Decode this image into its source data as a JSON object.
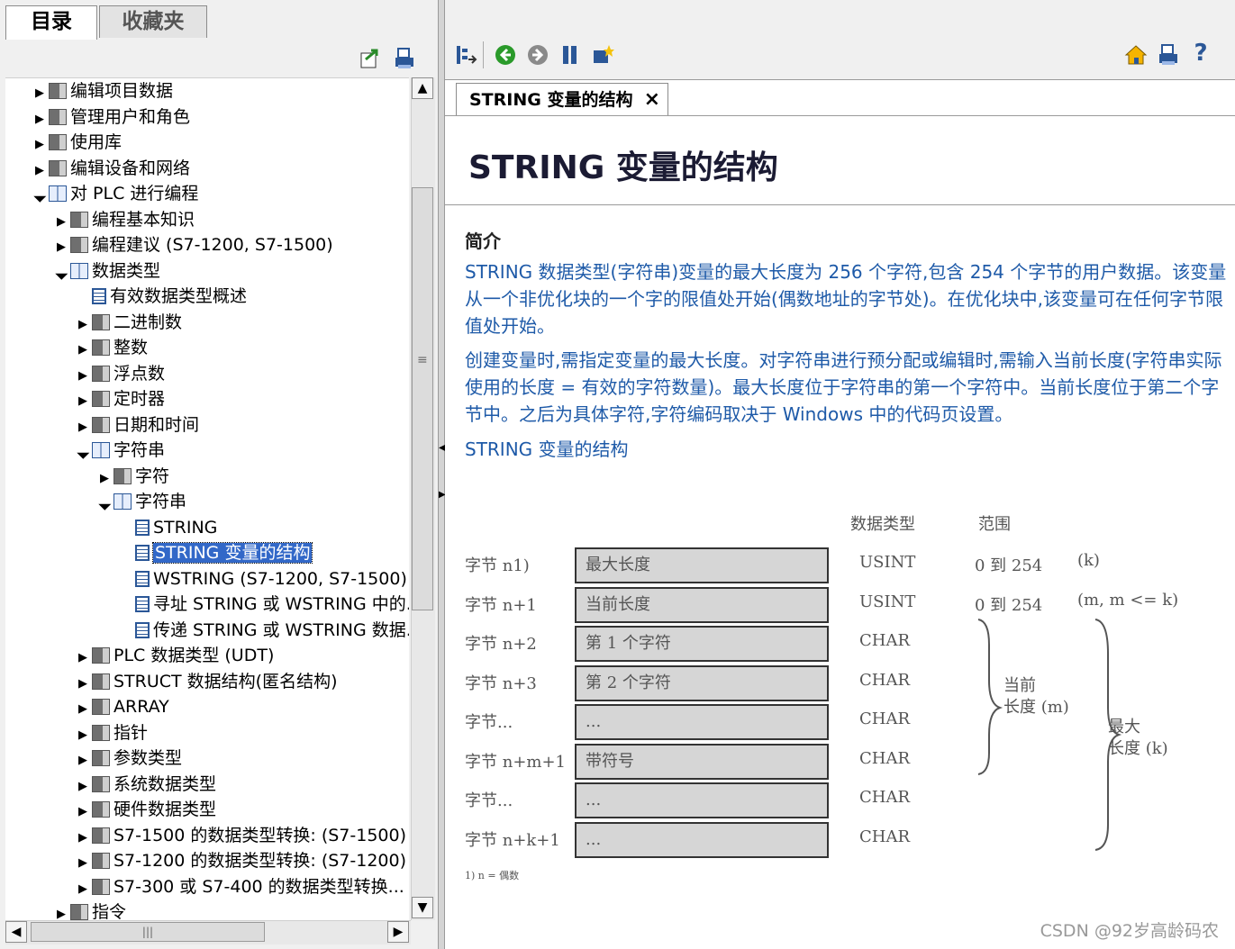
{
  "left": {
    "tabs": [
      "目录",
      "收藏夹"
    ],
    "tree": [
      {
        "label": "编辑项目数据",
        "level": 0,
        "state": "closed",
        "icon": "book"
      },
      {
        "label": "管理用户和角色",
        "level": 0,
        "state": "closed",
        "icon": "book"
      },
      {
        "label": "使用库",
        "level": 0,
        "state": "closed",
        "icon": "book"
      },
      {
        "label": "编辑设备和网络",
        "level": 0,
        "state": "closed",
        "icon": "book"
      },
      {
        "label": "对 PLC 进行编程",
        "level": 0,
        "state": "open",
        "icon": "openbook"
      },
      {
        "label": "编程基本知识",
        "level": 1,
        "state": "closed",
        "icon": "book"
      },
      {
        "label": "编程建议 (S7-1200, S7-1500)",
        "level": 1,
        "state": "closed",
        "icon": "book"
      },
      {
        "label": "数据类型",
        "level": 1,
        "state": "open",
        "icon": "openbook"
      },
      {
        "label": "有效数据类型概述",
        "level": 2,
        "state": "leaf",
        "icon": "page"
      },
      {
        "label": "二进制数",
        "level": 2,
        "state": "closed",
        "icon": "book"
      },
      {
        "label": "整数",
        "level": 2,
        "state": "closed",
        "icon": "book"
      },
      {
        "label": "浮点数",
        "level": 2,
        "state": "closed",
        "icon": "book"
      },
      {
        "label": "定时器",
        "level": 2,
        "state": "closed",
        "icon": "book"
      },
      {
        "label": "日期和时间",
        "level": 2,
        "state": "closed",
        "icon": "book"
      },
      {
        "label": "字符串",
        "level": 2,
        "state": "open",
        "icon": "openbook"
      },
      {
        "label": "字符",
        "level": 3,
        "state": "closed",
        "icon": "book"
      },
      {
        "label": "字符串",
        "level": 3,
        "state": "open",
        "icon": "openbook"
      },
      {
        "label": "STRING",
        "level": 4,
        "state": "leaf",
        "icon": "page"
      },
      {
        "label": "STRING 变量的结构",
        "level": 4,
        "state": "leaf",
        "icon": "page",
        "selected": true
      },
      {
        "label": "WSTRING (S7-1200, S7-1500)",
        "level": 4,
        "state": "leaf",
        "icon": "page"
      },
      {
        "label": "寻址 STRING 或 WSTRING 中的...",
        "level": 4,
        "state": "leaf",
        "icon": "page"
      },
      {
        "label": "传递 STRING 或 WSTRING 数据...",
        "level": 4,
        "state": "leaf",
        "icon": "page"
      },
      {
        "label": "PLC 数据类型 (UDT)",
        "level": 2,
        "state": "closed",
        "icon": "book"
      },
      {
        "label": "STRUCT 数据结构(匿名结构)",
        "level": 2,
        "state": "closed",
        "icon": "book"
      },
      {
        "label": "ARRAY",
        "level": 2,
        "state": "closed",
        "icon": "book"
      },
      {
        "label": "指针",
        "level": 2,
        "state": "closed",
        "icon": "book"
      },
      {
        "label": "参数类型",
        "level": 2,
        "state": "closed",
        "icon": "book"
      },
      {
        "label": "系统数据类型",
        "level": 2,
        "state": "closed",
        "icon": "book"
      },
      {
        "label": "硬件数据类型",
        "level": 2,
        "state": "closed",
        "icon": "book"
      },
      {
        "label": "S7-1500 的数据类型转换: (S7-1500)",
        "level": 2,
        "state": "closed",
        "icon": "book"
      },
      {
        "label": "S7-1200 的数据类型转换: (S7-1200)",
        "level": 2,
        "state": "closed",
        "icon": "book"
      },
      {
        "label": "S7-300 或 S7-400 的数据类型转换...",
        "level": 2,
        "state": "closed",
        "icon": "book"
      },
      {
        "label": "指令",
        "level": 1,
        "state": "closed",
        "icon": "book"
      }
    ],
    "scroll_glyph": "|||"
  },
  "right": {
    "tab_title": "STRING 变量的结构",
    "tab_close": "×",
    "topic_title": "STRING 变量的结构",
    "section_title": "简介",
    "paragraphs": [
      "STRING 数据类型(字符串)变量的最大长度为 256 个字符,包含 254 个字节的用户数据。该变量从一个非优化块的一个字的限值处开始(偶数地址的字节处)。在优化块中,该变量可在任何字节限值处开始。",
      "创建变量时,需指定变量的最大长度。对字符串进行预分配或编辑时,需输入当前长度(字符串实际使用的长度 = 有效的字符数量)。最大长度位于字符串的第一个字符中。当前长度位于第二个字节中。之后为具体字符,字符编码取决于 Windows 中的代码页设置。"
    ],
    "figure_caption": "STRING 变量的结构",
    "diagram": {
      "header_type": "数据类型",
      "header_range": "范围",
      "rows": [
        {
          "byte": "字节 n1)",
          "content": "最大长度",
          "type": "USINT",
          "range": "0 到 254",
          "note": "(k)"
        },
        {
          "byte": "字节 n+1",
          "content": "当前长度",
          "type": "USINT",
          "range": "0 到 254",
          "note": "(m, m <= k)"
        },
        {
          "byte": "字节 n+2",
          "content": "第 1 个字符",
          "type": "CHAR",
          "range": "",
          "note": ""
        },
        {
          "byte": "字节 n+3",
          "content": "第 2 个字符",
          "type": "CHAR",
          "range": "",
          "note": ""
        },
        {
          "byte": "字节...",
          "content": "...",
          "type": "CHAR",
          "range": "",
          "note": ""
        },
        {
          "byte": "字节 n+m+1",
          "content": "带符号",
          "type": "CHAR",
          "range": "",
          "note": ""
        },
        {
          "byte": "字节...",
          "content": "...",
          "type": "CHAR",
          "range": "",
          "note": ""
        },
        {
          "byte": "字节 n+k+1",
          "content": "...",
          "type": "CHAR",
          "range": "",
          "note": ""
        }
      ],
      "brace_current": [
        "当前",
        "长度 (m)"
      ],
      "brace_max": [
        "最大",
        "长度 (k)"
      ],
      "footnote": "1) n = 偶数"
    },
    "watermark": "CSDN @92岁高龄码农"
  },
  "colors": {
    "link_text": "#1e5aa8",
    "selection": "#3268c8",
    "chrome": "#f0f0f0"
  }
}
